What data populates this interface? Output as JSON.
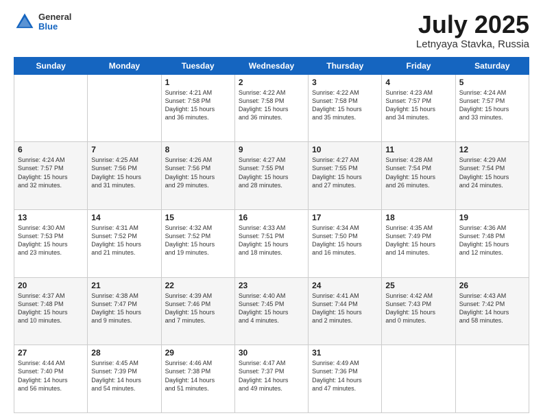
{
  "header": {
    "logo_general": "General",
    "logo_blue": "Blue",
    "month_title": "July 2025",
    "location": "Letnyaya Stavka, Russia"
  },
  "weekdays": [
    "Sunday",
    "Monday",
    "Tuesday",
    "Wednesday",
    "Thursday",
    "Friday",
    "Saturday"
  ],
  "rows": [
    [
      {
        "day": "",
        "content": ""
      },
      {
        "day": "",
        "content": ""
      },
      {
        "day": "1",
        "content": "Sunrise: 4:21 AM\nSunset: 7:58 PM\nDaylight: 15 hours\nand 36 minutes."
      },
      {
        "day": "2",
        "content": "Sunrise: 4:22 AM\nSunset: 7:58 PM\nDaylight: 15 hours\nand 36 minutes."
      },
      {
        "day": "3",
        "content": "Sunrise: 4:22 AM\nSunset: 7:58 PM\nDaylight: 15 hours\nand 35 minutes."
      },
      {
        "day": "4",
        "content": "Sunrise: 4:23 AM\nSunset: 7:57 PM\nDaylight: 15 hours\nand 34 minutes."
      },
      {
        "day": "5",
        "content": "Sunrise: 4:24 AM\nSunset: 7:57 PM\nDaylight: 15 hours\nand 33 minutes."
      }
    ],
    [
      {
        "day": "6",
        "content": "Sunrise: 4:24 AM\nSunset: 7:57 PM\nDaylight: 15 hours\nand 32 minutes."
      },
      {
        "day": "7",
        "content": "Sunrise: 4:25 AM\nSunset: 7:56 PM\nDaylight: 15 hours\nand 31 minutes."
      },
      {
        "day": "8",
        "content": "Sunrise: 4:26 AM\nSunset: 7:56 PM\nDaylight: 15 hours\nand 29 minutes."
      },
      {
        "day": "9",
        "content": "Sunrise: 4:27 AM\nSunset: 7:55 PM\nDaylight: 15 hours\nand 28 minutes."
      },
      {
        "day": "10",
        "content": "Sunrise: 4:27 AM\nSunset: 7:55 PM\nDaylight: 15 hours\nand 27 minutes."
      },
      {
        "day": "11",
        "content": "Sunrise: 4:28 AM\nSunset: 7:54 PM\nDaylight: 15 hours\nand 26 minutes."
      },
      {
        "day": "12",
        "content": "Sunrise: 4:29 AM\nSunset: 7:54 PM\nDaylight: 15 hours\nand 24 minutes."
      }
    ],
    [
      {
        "day": "13",
        "content": "Sunrise: 4:30 AM\nSunset: 7:53 PM\nDaylight: 15 hours\nand 23 minutes."
      },
      {
        "day": "14",
        "content": "Sunrise: 4:31 AM\nSunset: 7:52 PM\nDaylight: 15 hours\nand 21 minutes."
      },
      {
        "day": "15",
        "content": "Sunrise: 4:32 AM\nSunset: 7:52 PM\nDaylight: 15 hours\nand 19 minutes."
      },
      {
        "day": "16",
        "content": "Sunrise: 4:33 AM\nSunset: 7:51 PM\nDaylight: 15 hours\nand 18 minutes."
      },
      {
        "day": "17",
        "content": "Sunrise: 4:34 AM\nSunset: 7:50 PM\nDaylight: 15 hours\nand 16 minutes."
      },
      {
        "day": "18",
        "content": "Sunrise: 4:35 AM\nSunset: 7:49 PM\nDaylight: 15 hours\nand 14 minutes."
      },
      {
        "day": "19",
        "content": "Sunrise: 4:36 AM\nSunset: 7:48 PM\nDaylight: 15 hours\nand 12 minutes."
      }
    ],
    [
      {
        "day": "20",
        "content": "Sunrise: 4:37 AM\nSunset: 7:48 PM\nDaylight: 15 hours\nand 10 minutes."
      },
      {
        "day": "21",
        "content": "Sunrise: 4:38 AM\nSunset: 7:47 PM\nDaylight: 15 hours\nand 9 minutes."
      },
      {
        "day": "22",
        "content": "Sunrise: 4:39 AM\nSunset: 7:46 PM\nDaylight: 15 hours\nand 7 minutes."
      },
      {
        "day": "23",
        "content": "Sunrise: 4:40 AM\nSunset: 7:45 PM\nDaylight: 15 hours\nand 4 minutes."
      },
      {
        "day": "24",
        "content": "Sunrise: 4:41 AM\nSunset: 7:44 PM\nDaylight: 15 hours\nand 2 minutes."
      },
      {
        "day": "25",
        "content": "Sunrise: 4:42 AM\nSunset: 7:43 PM\nDaylight: 15 hours\nand 0 minutes."
      },
      {
        "day": "26",
        "content": "Sunrise: 4:43 AM\nSunset: 7:42 PM\nDaylight: 14 hours\nand 58 minutes."
      }
    ],
    [
      {
        "day": "27",
        "content": "Sunrise: 4:44 AM\nSunset: 7:40 PM\nDaylight: 14 hours\nand 56 minutes."
      },
      {
        "day": "28",
        "content": "Sunrise: 4:45 AM\nSunset: 7:39 PM\nDaylight: 14 hours\nand 54 minutes."
      },
      {
        "day": "29",
        "content": "Sunrise: 4:46 AM\nSunset: 7:38 PM\nDaylight: 14 hours\nand 51 minutes."
      },
      {
        "day": "30",
        "content": "Sunrise: 4:47 AM\nSunset: 7:37 PM\nDaylight: 14 hours\nand 49 minutes."
      },
      {
        "day": "31",
        "content": "Sunrise: 4:49 AM\nSunset: 7:36 PM\nDaylight: 14 hours\nand 47 minutes."
      },
      {
        "day": "",
        "content": ""
      },
      {
        "day": "",
        "content": ""
      }
    ]
  ]
}
